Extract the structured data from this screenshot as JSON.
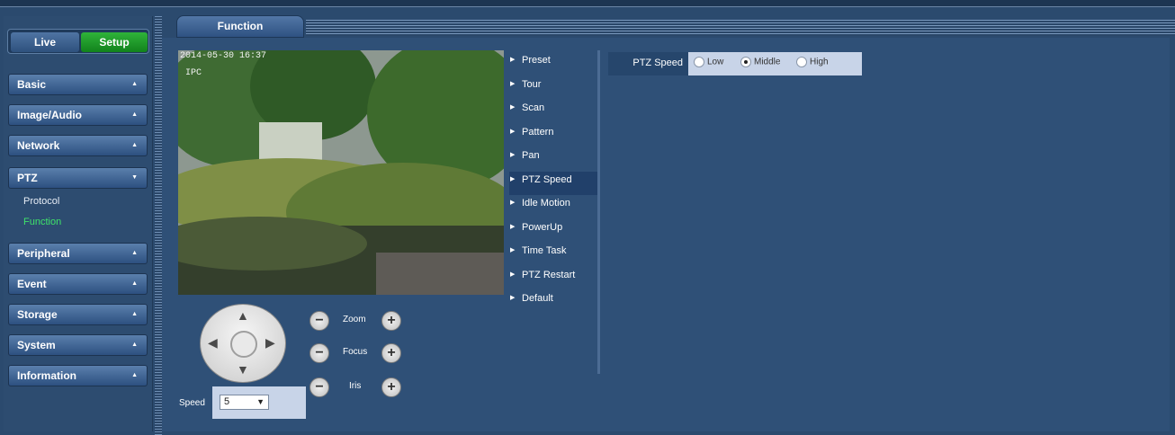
{
  "tabs": {
    "live": "Live",
    "setup": "Setup"
  },
  "nav": [
    {
      "label": "Basic"
    },
    {
      "label": "Image/Audio"
    },
    {
      "label": "Network"
    },
    {
      "label": "PTZ"
    },
    {
      "label": "Peripheral"
    },
    {
      "label": "Event"
    },
    {
      "label": "Storage"
    },
    {
      "label": "System"
    },
    {
      "label": "Information"
    }
  ],
  "ptz_sub": {
    "protocol": "Protocol",
    "function": "Function"
  },
  "page_tab": "Function",
  "video": {
    "timestamp": "2014-05-30 16:37",
    "channel": "IPC"
  },
  "function_menu": [
    "Preset",
    "Tour",
    "Scan",
    "Pattern",
    "Pan",
    "PTZ Speed",
    "Idle Motion",
    "PowerUp",
    "Time Task",
    "PTZ Restart",
    "Default"
  ],
  "selected_menu": "PTZ Speed",
  "ptz_speed": {
    "label": "PTZ Speed",
    "options": [
      "Low",
      "Middle",
      "High"
    ],
    "selected": "Middle"
  },
  "controls": {
    "zoom": "Zoom",
    "focus": "Focus",
    "iris": "Iris"
  },
  "speed": {
    "label": "Speed",
    "value": "5"
  },
  "colors": {
    "setup_tab": "#1e9a2a",
    "active_subitem": "#3fe36a",
    "background": "#2f5077"
  }
}
